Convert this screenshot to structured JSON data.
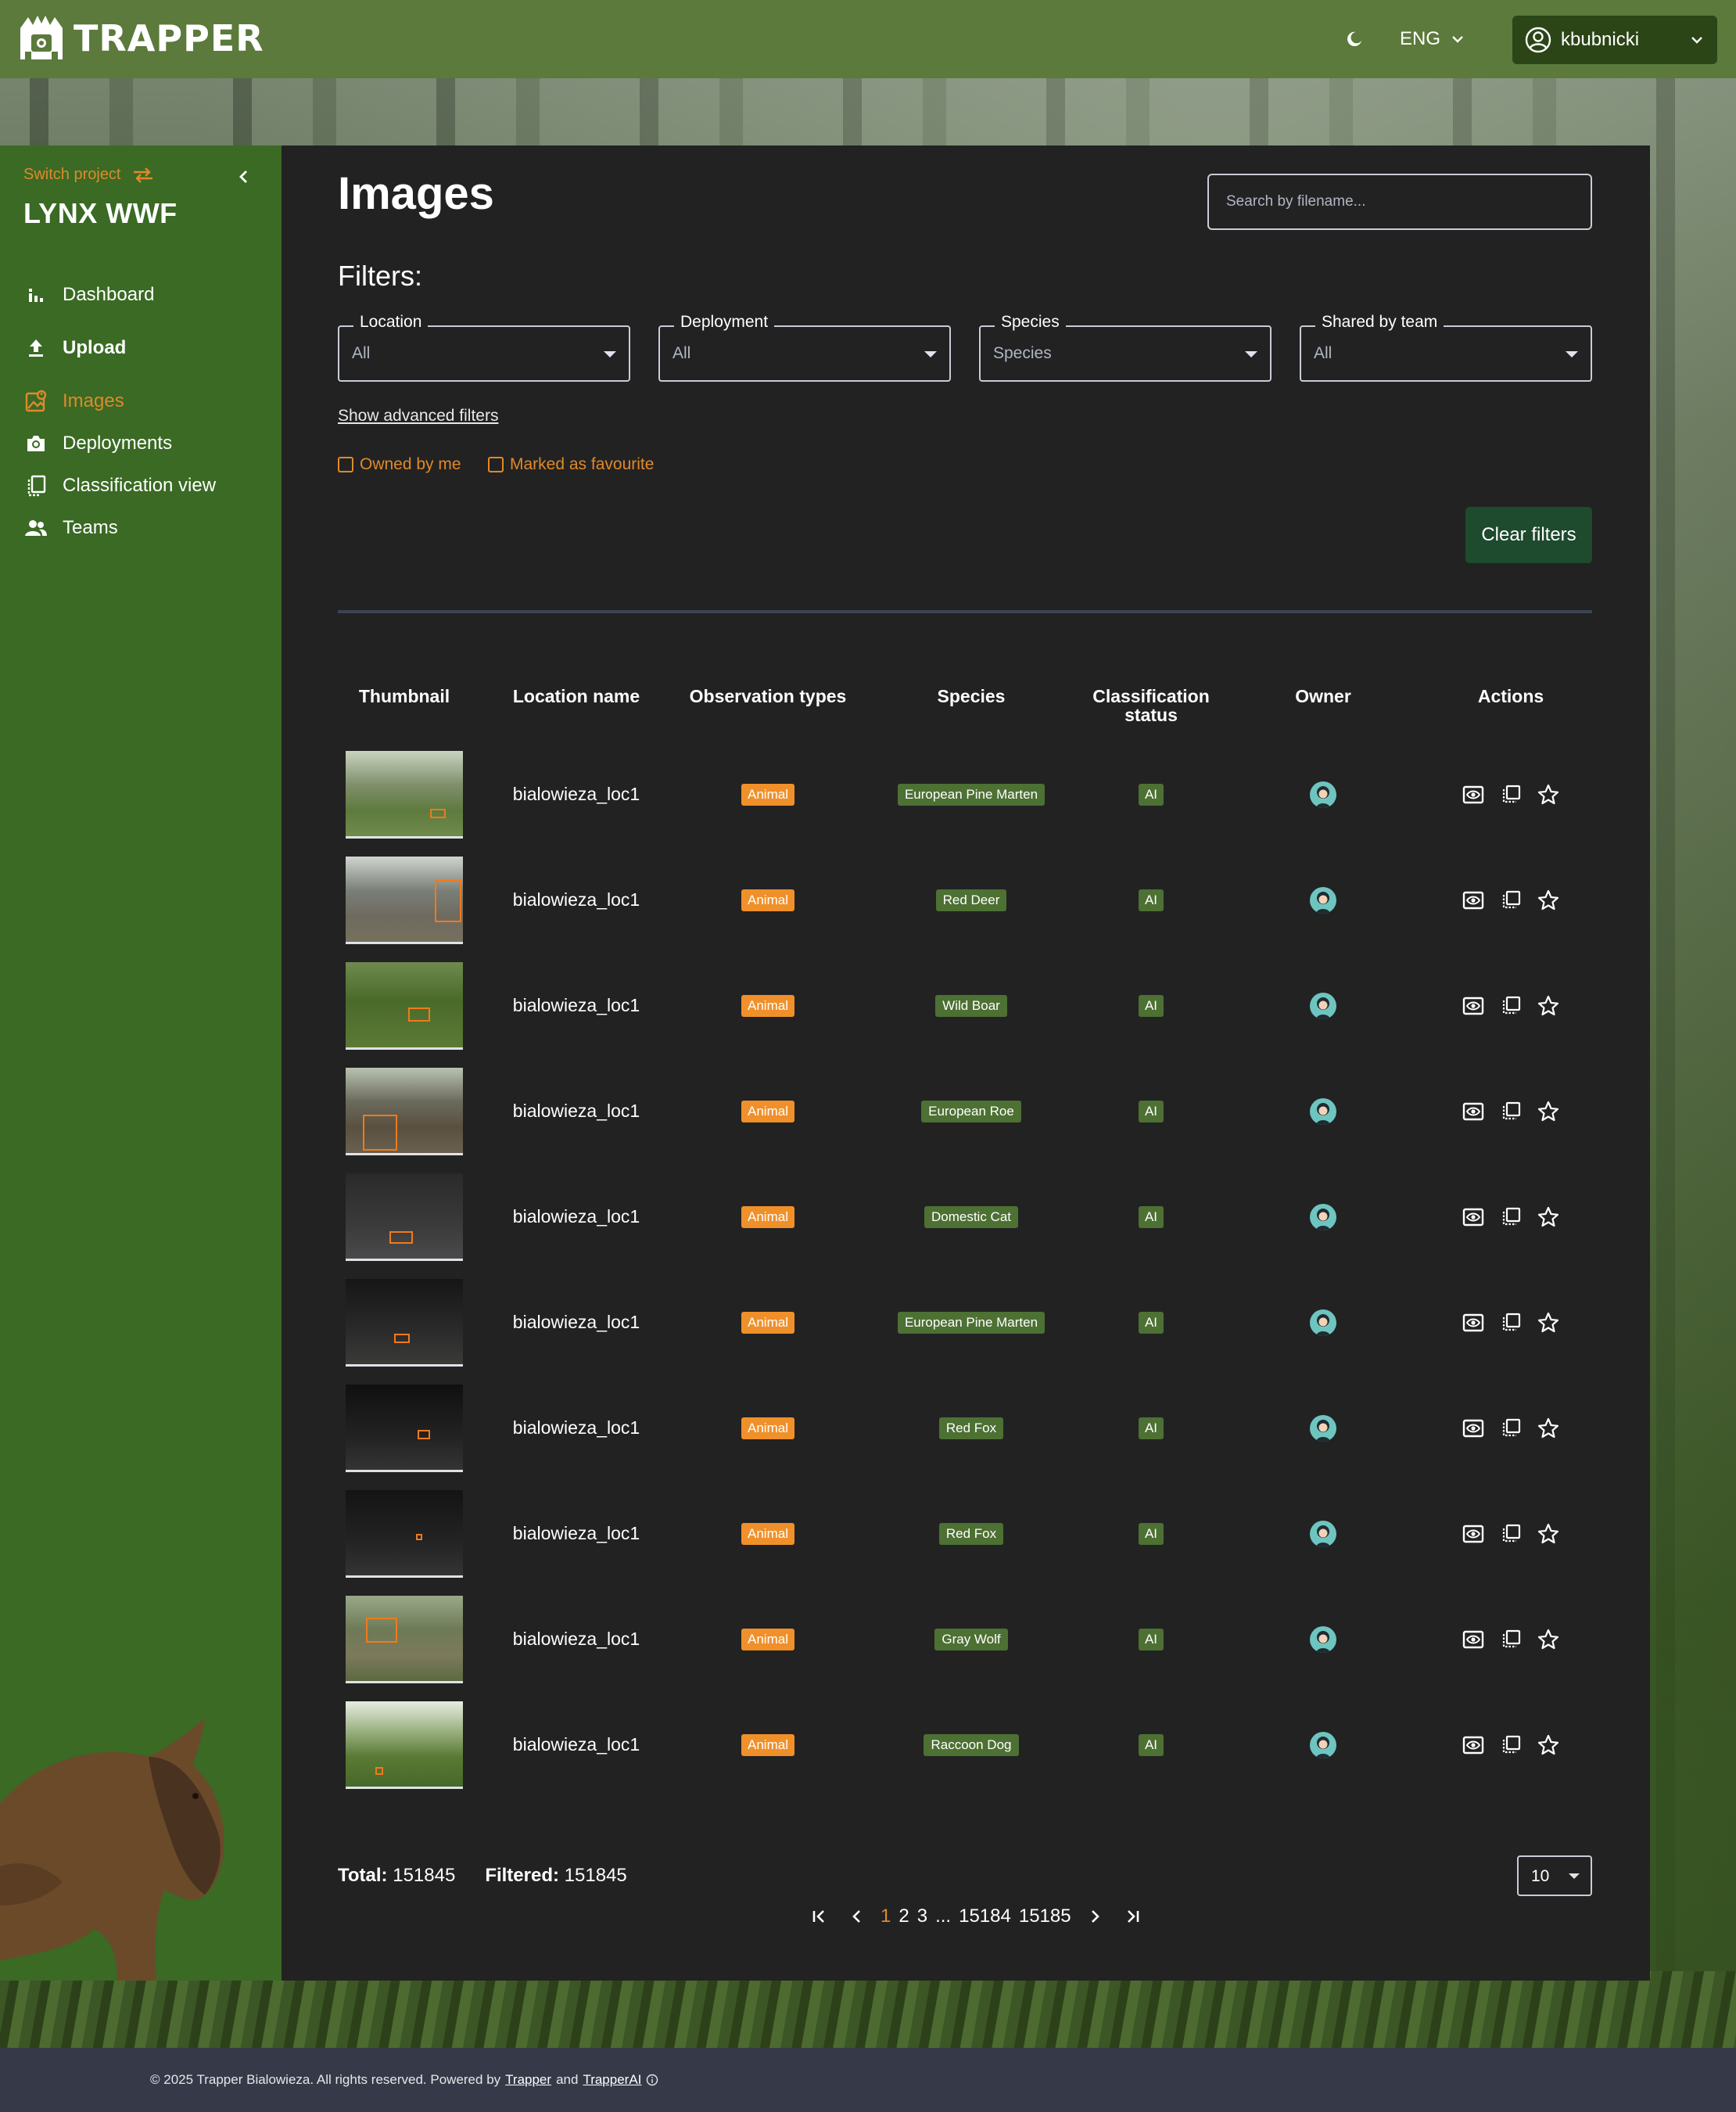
{
  "app": {
    "logo_text": "TRAPPER"
  },
  "header": {
    "language": "ENG",
    "username": "kbubnicki"
  },
  "sidebar": {
    "switch_project_label": "Switch project",
    "project_name": "LYNX WWF",
    "items": [
      {
        "label": "Dashboard",
        "icon": "bar-chart-icon"
      },
      {
        "label": "Upload",
        "icon": "upload-icon"
      },
      {
        "label": "Images",
        "icon": "images-icon"
      },
      {
        "label": "Deployments",
        "icon": "camera-icon"
      },
      {
        "label": "Classification view",
        "icon": "classification-icon"
      },
      {
        "label": "Teams",
        "icon": "team-icon"
      }
    ]
  },
  "main": {
    "title": "Images",
    "search_placeholder": "Search by filename...",
    "filters_title": "Filters:",
    "filters": [
      {
        "label": "Location",
        "value": "All"
      },
      {
        "label": "Deployment",
        "value": "All"
      },
      {
        "label": "Species",
        "value": "Species"
      },
      {
        "label": "Shared by team",
        "value": "All"
      }
    ],
    "show_advanced": "Show advanced filters",
    "checkbox_owned": "Owned by me",
    "checkbox_favourite": "Marked as favourite",
    "clear_filters": "Clear filters"
  },
  "table": {
    "headers": {
      "thumbnail": "Thumbnail",
      "location": "Location name",
      "obs": "Observation types",
      "species": "Species",
      "class1": "Classification",
      "class2": "status",
      "owner": "Owner",
      "actions": "Actions"
    },
    "rows": [
      {
        "location": "bialowieza_loc1",
        "obs": "Animal",
        "species": "European Pine Marten",
        "status": "AI"
      },
      {
        "location": "bialowieza_loc1",
        "obs": "Animal",
        "species": "Red Deer",
        "status": "AI"
      },
      {
        "location": "bialowieza_loc1",
        "obs": "Animal",
        "species": "Wild Boar",
        "status": "AI"
      },
      {
        "location": "bialowieza_loc1",
        "obs": "Animal",
        "species": "European Roe",
        "status": "AI"
      },
      {
        "location": "bialowieza_loc1",
        "obs": "Animal",
        "species": "Domestic Cat",
        "status": "AI"
      },
      {
        "location": "bialowieza_loc1",
        "obs": "Animal",
        "species": "European Pine Marten",
        "status": "AI"
      },
      {
        "location": "bialowieza_loc1",
        "obs": "Animal",
        "species": "Red Fox",
        "status": "AI"
      },
      {
        "location": "bialowieza_loc1",
        "obs": "Animal",
        "species": "Red Fox",
        "status": "AI"
      },
      {
        "location": "bialowieza_loc1",
        "obs": "Animal",
        "species": "Gray Wolf",
        "status": "AI"
      },
      {
        "location": "bialowieza_loc1",
        "obs": "Animal",
        "species": "Raccoon Dog",
        "status": "AI"
      }
    ]
  },
  "stats": {
    "total_label": "Total:",
    "total": "151845",
    "filtered_label": "Filtered:",
    "filtered": "151845"
  },
  "pagination": {
    "pages": [
      "1",
      "2",
      "3",
      "...",
      "15184",
      "15185"
    ],
    "current": "1",
    "per_page": "10"
  },
  "footer": {
    "text": "© 2025 Trapper Bialowieza. All rights reserved. Powered by",
    "link1": "Trapper",
    "and": "and",
    "link2": "TrapperAI"
  },
  "colors": {
    "accent": "#e0892a",
    "topbar": "#5b7a3b",
    "sidebar": "#3a6a24",
    "panel": "#222222",
    "species_tag": "#4d7033",
    "clear_button": "#1e4a2e"
  }
}
